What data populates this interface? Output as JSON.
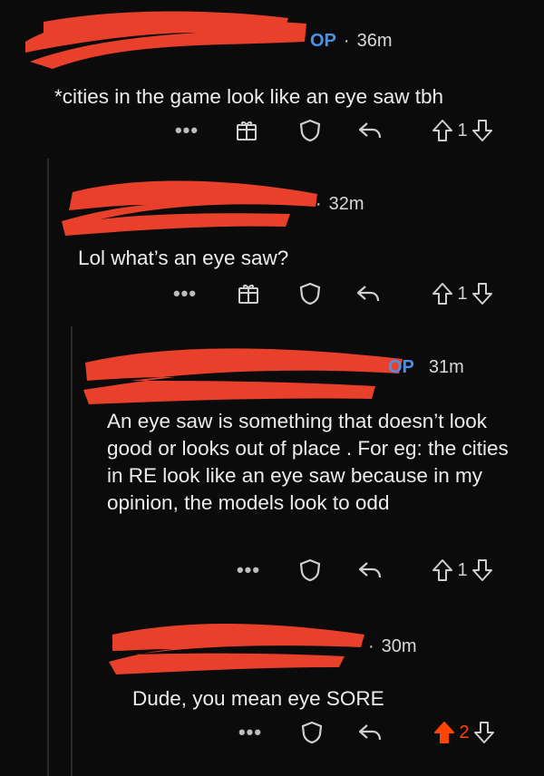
{
  "comments": [
    {
      "author_tag": "OP",
      "separator": "·",
      "time": "36m",
      "body": "*cities in the game look like an eye saw tbh",
      "more": "•••",
      "vote_count": "1",
      "upvoted": false,
      "has_award": true
    },
    {
      "author_tag": "",
      "separator": "·",
      "time": "32m",
      "body": "Lol what’s an eye saw?",
      "more": "•••",
      "vote_count": "1",
      "upvoted": false,
      "has_award": true
    },
    {
      "author_tag": "OP",
      "separator": "",
      "time": "31m",
      "body": "An eye saw is something that doesn’t look good or looks out of place . For eg: the cities in RE look like an eye saw because in my opinion, the models look to odd",
      "more": "•••",
      "vote_count": "1",
      "upvoted": false,
      "has_award": false
    },
    {
      "author_tag": "",
      "separator": "·",
      "time": "30m",
      "body": "Dude, you mean eye SORE",
      "more": "•••",
      "vote_count": "2",
      "upvoted": true,
      "has_award": false
    }
  ],
  "icons": {
    "award": "gift-icon",
    "save": "shield-icon",
    "reply": "reply-arrow-icon",
    "upvote": "upvote-arrow-icon",
    "downvote": "downvote-arrow-icon",
    "redaction": "red-scribble"
  },
  "colors": {
    "background": "#0b0b0c",
    "redaction": "#e8402a",
    "op_tag": "#4a8fe8",
    "upvoted": "#ff4500"
  }
}
